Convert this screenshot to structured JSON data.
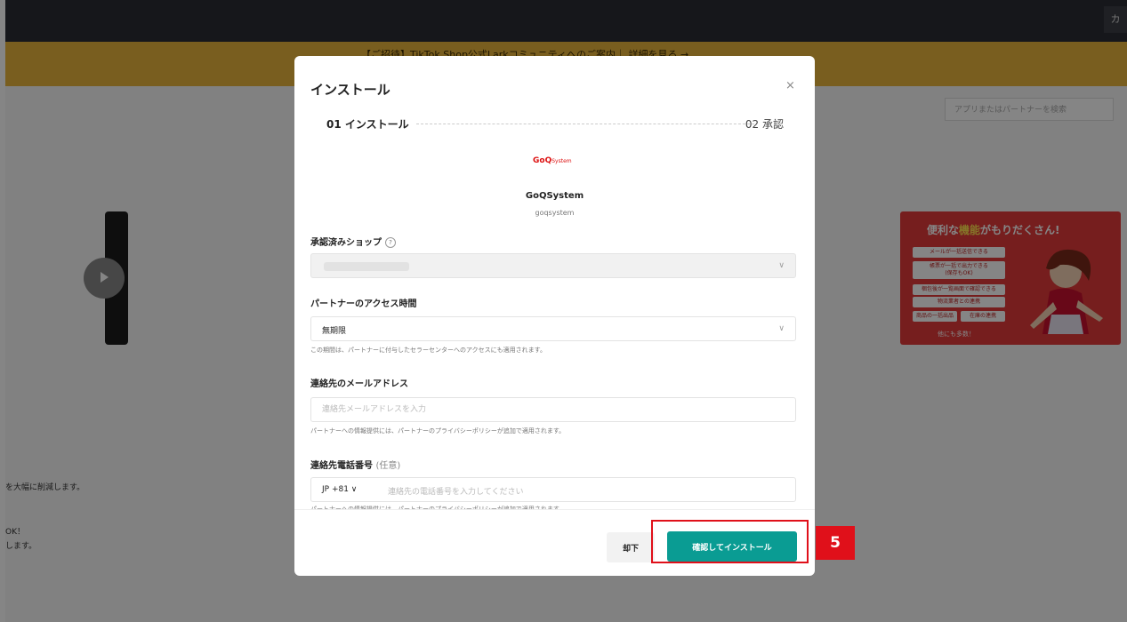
{
  "background": {
    "top_right_label": "カ",
    "banner_text": "【ご招待】TikTok Shop公式Larkコミュニティへのご案内｜ 詳細を見る →",
    "search_placeholder": "アプリまたはパートナーを検索",
    "left_text_1": "を大幅に削減します。",
    "left_text_2": "OK！",
    "left_text_3": "します。",
    "promo": {
      "title_plain": "便利な",
      "title_highlight": "機能",
      "title_suffix": "がもりだくさん!",
      "box_1": "メールが一括送信できる",
      "box_2": "帳票が一括で出力できる",
      "box_2_sub": "(保存もOK)",
      "box_3": "梱包後が一覧画面で確認できる",
      "box_4": "物流業者との連携",
      "box_5": "商品の一括出品",
      "box_6": "在庫の連携",
      "footer": "他にも多数！"
    }
  },
  "modal": {
    "title": "インストール",
    "close_icon": "×",
    "step1": "01 インストール",
    "step2": "02 承認",
    "logo_main": "GoQ",
    "logo_sub": "System",
    "app_name": "GoQSystem",
    "app_id": "goqsystem",
    "shop_label": "承認済みショップ",
    "shop_help_icon": "?",
    "access_label": "パートナーのアクセス時間",
    "access_value": "無期限",
    "access_help": "この期間は、パートナーに付与したセラーセンターへのアクセスにも適用されます。",
    "email_label": "連絡先のメールアドレス",
    "email_placeholder": "連絡先メールアドレスを入力",
    "email_help": "パートナーへの情報提供には、パートナーのプライバシーポリシーが追加で適用されます。",
    "phone_label": "連絡先電話番号",
    "phone_optional": "(任意)",
    "phone_country": "JP +81 ∨",
    "phone_placeholder": "連絡先の電話番号を入力してください",
    "phone_help": "パートナーへの情報提供には、パートナーのプライバシーポリシーが追加で適用されます。",
    "chevron": "∨",
    "reject_button": "却下",
    "confirm_button": "確認してインストール"
  },
  "annotation": {
    "step_number": "5",
    "highlight_color": "#e0101a"
  },
  "colors": {
    "primary": "#0a9c93",
    "banner": "#e8b53d",
    "topbar": "#2b2d35"
  }
}
